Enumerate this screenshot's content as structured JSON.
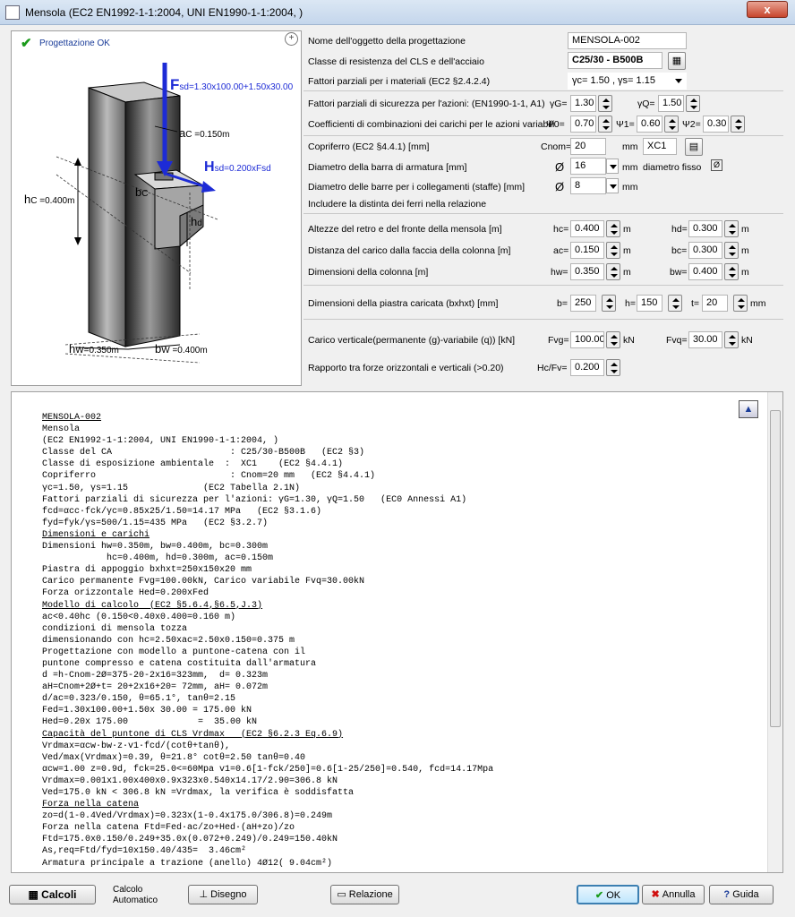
{
  "window": {
    "title": "Mensola (EC2 EN1992-1-1:2004, UNI EN1990-1-1:2004, )",
    "close": "x"
  },
  "status": {
    "text": "Progettazione OK"
  },
  "drawing": {
    "fsd": "F",
    "fsd_sub": "sd=1.30x100.00+1.50x30.00",
    "ac": "a",
    "ac_sub": "C =0.150m",
    "hsd": "H",
    "hsd_sub": "sd=0.200xFsd",
    "bc": "b",
    "bc_sub": "C",
    "hd": "h",
    "hd_sub": "d",
    "hc": "h",
    "hc_sub": "C =0.400m",
    "hw": "h",
    "hw_sub": "W=0.350m",
    "bw": "b",
    "bw_sub": "W =0.400m"
  },
  "form": {
    "nome_label": "Nome dell'oggetto della progettazione",
    "nome_value": "MENSOLA-002",
    "classe_label": "Classe di resistenza del CLS e dell'acciaio",
    "classe_value": "C25/30 - B500B",
    "fattori_mat_label": "Fattori parziali per i materiali (EC2 §2.4.2.4)",
    "fattori_mat_value": "γc= 1.50 , γs= 1.15",
    "fattori_az_label": "Fattori parziali di sicurezza per l'azioni: (EN1990-1-1, A1)",
    "gG_label": "γG=",
    "gG": "1.30",
    "gQ_label": "γQ=",
    "gQ": "1.50",
    "coef_label": "Coefficienti di combinazioni dei carichi per le azioni variabili",
    "psi0_label": "Ψ0=",
    "psi0": "0.70",
    "psi1_label": "Ψ1=",
    "psi1": "0.60",
    "psi2_label": "Ψ2=",
    "psi2": "0.30",
    "copriferro_label": "Copriferro (EC2 §4.4.1) [mm]",
    "cnom_label": "Cnom=",
    "cnom": "20",
    "cnom_unit": "mm",
    "xc": "XC1",
    "diam_label": "Diametro della barra di armatura [mm]",
    "diam_sym": "Ø",
    "diam": "16",
    "diam_unit": "mm",
    "diam_fisso": "diametro fisso",
    "diam_check": "Ø",
    "diam_staffe_label": "Diametro delle barre per i collegamenti (staffe) [mm]",
    "staffe_sym": "Ø",
    "staffe": "8",
    "staffe_unit": "mm",
    "includere_label": "Includere la distinta dei ferri nella relazione",
    "altezze_label": "Altezze del retro e del fronte della mensola [m]",
    "hc_label": "hc=",
    "hc": "0.400",
    "hc_unit": "m",
    "hd_label": "hd=",
    "hd": "0.300",
    "hd_unit": "m",
    "distanza_label": "Distanza del carico dalla faccia della colonna [m]",
    "ac_label": "ac=",
    "ac": "0.150",
    "ac_unit": "m",
    "bc_label": "bc=",
    "bc": "0.300",
    "bc_unit": "m",
    "dim_col_label": "Dimensioni della colonna [m]",
    "hw_label": "hw=",
    "hw": "0.350",
    "hw_unit": "m",
    "bw_label": "bw=",
    "bw": "0.400",
    "bw_unit": "m",
    "piastra_label": "Dimensioni della piastra caricata (bxhxt) [mm]",
    "b_label": "b=",
    "b": "250",
    "h_label": "h=",
    "h": "150",
    "t_label": "t=",
    "t": "20",
    "t_unit": "mm",
    "carico_label": "Carico verticale(permanente (g)-variabile (q)) [kN]",
    "fvg_label": "Fvg=",
    "fvg": "100.00",
    "fvg_unit": "kN",
    "fvq_label": "Fvq=",
    "fvq": "30.00",
    "fvq_unit": "kN",
    "rapporto_label": "Rapporto tra forze orizzontali e verticali (>0.20)",
    "hcfv_label": "Hc/Fv=",
    "hcfv": "0.200"
  },
  "report": {
    "lines": [
      {
        "t": "MENSOLA-002",
        "u": true
      },
      {
        "t": "Mensola"
      },
      {
        "t": "(EC2 EN1992-1-1:2004, UNI EN1990-1-1:2004, )"
      },
      {
        "t": "Classe del CA                      : C25/30-B500B   (EC2 §3)"
      },
      {
        "t": "Classe di esposizione ambientale  :  XC1    (EC2 §4.4.1)"
      },
      {
        "t": "Copriferro                         : Cnom=20 mm   (EC2 §4.4.1)"
      },
      {
        "t": "γc=1.50, γs=1.15              (EC2 Tabella 2.1N)"
      },
      {
        "t": "Fattori parziali di sicurezza per l'azioni: γG=1.30, γQ=1.50   (EC0 Annessi A1)"
      },
      {
        "t": "fcd=αcc·fck/γc=0.85x25/1.50=14.17 MPa   (EC2 §3.1.6)"
      },
      {
        "t": "fyd=fyk/γs=500/1.15=435 MPa   (EC2 §3.2.7)"
      },
      {
        "t": "Dimensioni e carichi",
        "u": true
      },
      {
        "t": "Dimensioni hw=0.350m, bw=0.400m, bc=0.300m"
      },
      {
        "t": "            hc=0.400m, hd=0.300m, ac=0.150m"
      },
      {
        "t": "Piastra di appoggio bxhxt=250x150x20 mm"
      },
      {
        "t": "Carico permanente Fvg=100.00kN, Carico variabile Fvq=30.00kN"
      },
      {
        "t": "Forza orizzontale Hed=0.200xFed"
      },
      {
        "t": "Modello di calcolo  (EC2 §5.6.4,§6.5,J.3)",
        "u": true
      },
      {
        "t": "ac<0.40hc (0.150<0.40x0.400=0.160 m)"
      },
      {
        "t": "condizioni di mensola tozza"
      },
      {
        "t": "dimensionando con hc=2.50xac=2.50x0.150=0.375 m"
      },
      {
        "t": "Progettazione con modello a puntone-catena con il"
      },
      {
        "t": "puntone compresso e catena costituita dall'armatura"
      },
      {
        "t": "d =h-Cnom-2Ø=375-20-2x16=323mm,  d= 0.323m"
      },
      {
        "t": "aH=Cnom+2Ø+t= 20+2x16+20= 72mm, aH= 0.072m"
      },
      {
        "t": "d/ac=0.323/0.150, θ=65.1°, tanθ=2.15"
      },
      {
        "t": "Fed=1.30x100.00+1.50x 30.00 = 175.00 kN"
      },
      {
        "t": "Hed=0.20x 175.00             =  35.00 kN"
      },
      {
        "t": "Capacità del puntone di CLS Vrdmax   (EC2 §6.2.3 Eq.6.9)",
        "u": true
      },
      {
        "t": "Vrdmax=αcw·bw·z·v1·fcd/(cotθ+tanθ),"
      },
      {
        "t": "Ved/max(Vrdmax)=0.39, θ=21.8° cotθ=2.50 tanθ=0.40"
      },
      {
        "t": "αcw=1.00 z=0.9d, fck=25.0<=60Mpa v1=0.6[1-fck/250]=0.6[1-25/250]=0.540, fcd=14.17Mpa"
      },
      {
        "t": "Vrdmax=0.001x1.00x400x0.9x323x0.540x14.17/2.90=306.8 kN"
      },
      {
        "t": "Ved=175.0 kN < 306.8 kN =Vrdmax, la verifica è soddisfatta"
      },
      {
        "t": "Forza nella catena",
        "u": true
      },
      {
        "t": "zo=d(1-0.4Ved/Vrdmax)=0.323x(1-0.4x175.0/306.8)=0.249m"
      },
      {
        "t": "Forza nella catena Ftd=Fed·ac/zo+Hed·(aH+zo)/zo"
      },
      {
        "t": "Ftd=175.0x0.150/0.249+35.0x(0.072+0.249)/0.249=150.40kN"
      },
      {
        "t": "As,req=Ftd/fyd=10x150.40/435=  3.46cm²"
      },
      {
        "t": "Armatura principale a trazione (anello) 4Ø12( 9.04cm²)"
      }
    ]
  },
  "buttons": {
    "calcoli": "Calcoli",
    "calcolo_auto_1": "Calcolo",
    "calcolo_auto_2": "Automatico",
    "disegno": "Disegno",
    "relazione": "Relazione",
    "ok": "OK",
    "annulla": "Annulla",
    "guida": "Guida"
  }
}
